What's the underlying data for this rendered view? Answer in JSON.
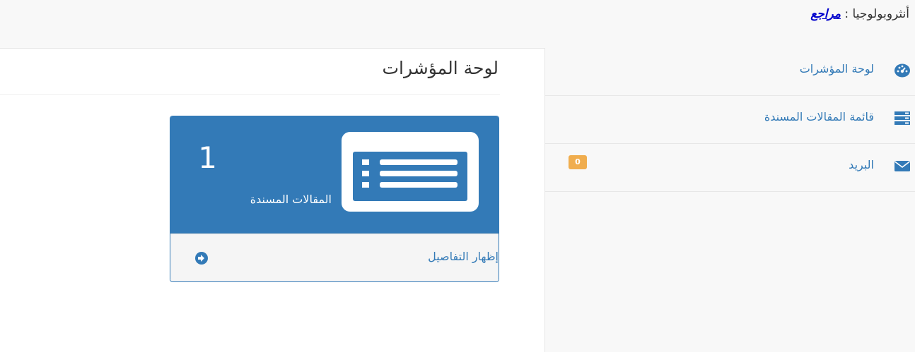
{
  "header": {
    "username": "أنثروبولوجيا",
    "separator": ":",
    "role": "مراجع"
  },
  "sidebar": {
    "items": [
      {
        "label": "لوحة المؤشرات",
        "icon": "dashboard-icon"
      },
      {
        "label": "قائمة المقالات المسندة",
        "icon": "list-tasks-icon"
      },
      {
        "label": "البريد",
        "icon": "envelope-icon",
        "badge": "0"
      }
    ]
  },
  "main": {
    "title": "لوحة المؤشرات",
    "panel": {
      "count": "1",
      "caption": "المقالات المسندة",
      "footer_label": "إظهار التفاصيل",
      "icon": "list-alt-icon",
      "footer_icon": "arrow-circle-right-icon"
    }
  },
  "colors": {
    "primary": "#337ab7",
    "badge": "#f0ad4e",
    "role_link": "#0000cc",
    "sidebar_bg": "#f8f8f8"
  }
}
